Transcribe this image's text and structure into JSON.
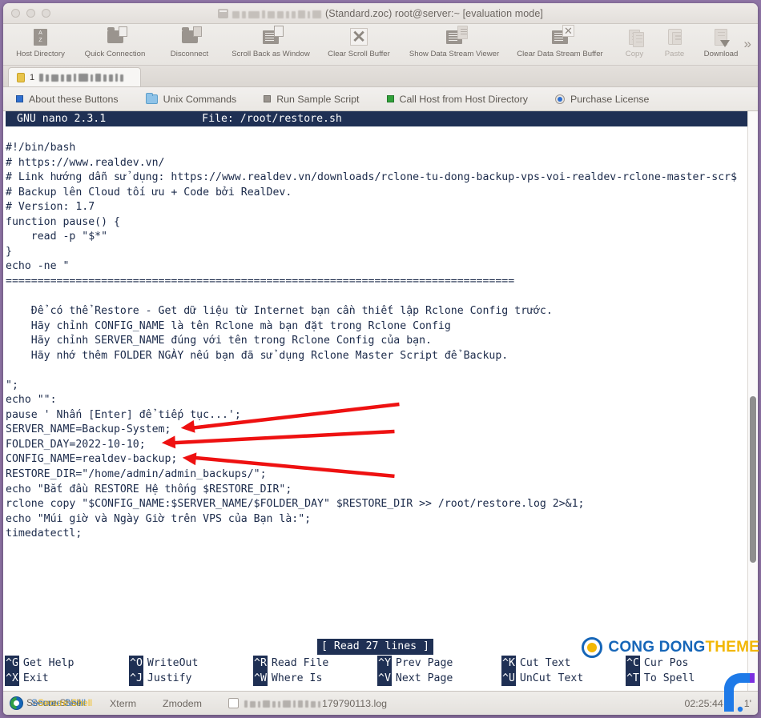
{
  "window": {
    "title_text": "(Standard.zoc) root@server:~ [evaluation mode]",
    "title_redacted": true
  },
  "toolbar": {
    "items": [
      {
        "label": "Host Directory",
        "icon": "az-book-icon",
        "enabled": true
      },
      {
        "label": "Quick Connection",
        "icon": "folder-connect-icon",
        "enabled": true
      },
      {
        "label": "Disconnect",
        "icon": "folder-disconnect-icon",
        "enabled": true
      },
      {
        "label": "Scroll Back as Window",
        "icon": "scrollback-window-icon",
        "enabled": true
      },
      {
        "label": "Clear Scroll Buffer",
        "icon": "clear-scroll-x-icon",
        "enabled": true
      },
      {
        "label": "Show Data Stream Viewer",
        "icon": "data-stream-viewer-icon",
        "enabled": true
      },
      {
        "label": "Clear Data Stream Buffer",
        "icon": "clear-data-stream-icon",
        "enabled": true
      },
      {
        "label": "Copy",
        "icon": "copy-icon",
        "enabled": false
      },
      {
        "label": "Paste",
        "icon": "paste-icon",
        "enabled": false
      },
      {
        "label": "Download",
        "icon": "download-icon",
        "enabled": true
      }
    ],
    "overflow_glyph": "»"
  },
  "tabs": [
    {
      "number": "1",
      "label_redacted": true,
      "active": true
    }
  ],
  "buttonbar": {
    "items": [
      {
        "label": "About these Buttons",
        "marker": "blue-square"
      },
      {
        "label": "Unix Commands",
        "marker": "folder-icon"
      },
      {
        "label": "Run Sample Script",
        "marker": "grey-square"
      },
      {
        "label": "Call Host from Host Directory",
        "marker": "green-square"
      },
      {
        "label": "Purchase License",
        "marker": "blue-radio"
      }
    ]
  },
  "nano": {
    "version_label": "GNU nano 2.3.1",
    "file_label": "File: /root/restore.sh",
    "status_label": "[ Read 27 lines ]",
    "code_lines": [
      "#!/bin/bash",
      "# https://www.realdev.vn/",
      "# Link hướng dẫn sử dụng: https://www.realdev.vn/downloads/rclone-tu-dong-backup-vps-voi-realdev-rclone-master-scr$",
      "# Backup lên Cloud tối ưu + Code bởi RealDev.",
      "# Version: 1.7",
      "function pause() {",
      "    read -p \"$*\"",
      "}",
      "echo -ne \"",
      "================================================================================",
      "",
      "    Để có thể Restore - Get dữ liệu từ Internet bạn cần thiết lập Rclone Config trước.",
      "    Hãy chỉnh CONFIG_NAME là tên Rclone mà bạn đặt trong Rclone Config",
      "    Hãy chỉnh SERVER_NAME đúng với tên trong Rclone Config của bạn.",
      "    Hãy nhớ thêm FOLDER NGÀY nếu bạn đã sử dụng Rclone Master Script để Backup.",
      "",
      "\";",
      "echo \"\":",
      "pause ' Nhấn [Enter] để tiếp tục...';",
      "SERVER_NAME=Backup-System;",
      "FOLDER_DAY=2022-10-10;",
      "CONFIG_NAME=realdev-backup;",
      "RESTORE_DIR=\"/home/admin/admin_backups/\";",
      "echo \"Bắt đầu RESTORE Hệ thống $RESTORE_DIR\";",
      "rclone copy \"$CONFIG_NAME:$SERVER_NAME/$FOLDER_DAY\" $RESTORE_DIR >> /root/restore.log 2>&1;",
      "echo \"Múi giờ và Ngày Giờ trên VPS của Bạn là:\";",
      "timedatectl;"
    ],
    "shortcuts": [
      {
        "key": "^G",
        "label": "Get Help"
      },
      {
        "key": "^O",
        "label": "WriteOut"
      },
      {
        "key": "^R",
        "label": "Read File"
      },
      {
        "key": "^Y",
        "label": "Prev Page"
      },
      {
        "key": "^K",
        "label": "Cut Text"
      },
      {
        "key": "^C",
        "label": "Cur Pos"
      },
      {
        "key": "^X",
        "label": "Exit"
      },
      {
        "key": "^J",
        "label": "Justify"
      },
      {
        "key": "^W",
        "label": "Where Is"
      },
      {
        "key": "^V",
        "label": "Next Page"
      },
      {
        "key": "^U",
        "label": "UnCut Text"
      },
      {
        "key": "^T",
        "label": "To Spell"
      }
    ]
  },
  "annotations": {
    "arrow_color": "#ee1111",
    "arrows": [
      {
        "target_line": "SERVER_NAME=Backup-System;"
      },
      {
        "target_line": "FOLDER_DAY=2022-10-10;"
      },
      {
        "target_line": "CONFIG_NAME=realdev-backup;"
      }
    ]
  },
  "watermark": {
    "text_primary": "CONG DONG",
    "text_secondary": "THEME",
    "color_primary": "#1666b8",
    "color_secondary": "#f2b705"
  },
  "statusbar": {
    "secure_shell_label": "Secure Shell",
    "items": [
      "Xterm",
      "Zmodem"
    ],
    "log_name": "179790113.log",
    "log_redacted": true,
    "time": "02:25:44",
    "trailing": "1'"
  }
}
